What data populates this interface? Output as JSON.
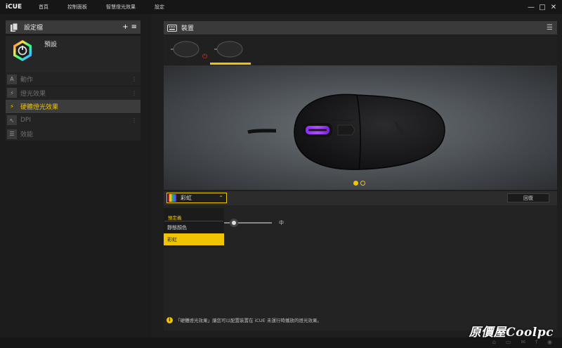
{
  "app": {
    "title": "iCUE"
  },
  "nav": [
    "首頁",
    "控制面板",
    "智慧燈光效果",
    "設定"
  ],
  "window_controls": [
    "—",
    "□",
    "✕"
  ],
  "profiles": {
    "title": "設定檔",
    "add": "+",
    "menu": "≡",
    "items": [
      {
        "name": "預設"
      }
    ]
  },
  "menu": [
    {
      "label": "動作",
      "icon": "A",
      "active": false,
      "more": "⋮"
    },
    {
      "label": "燈光效果",
      "icon": "⚡",
      "active": false,
      "more": "⋮"
    },
    {
      "label": "硬體燈光效果",
      "icon": "⚡",
      "active": true,
      "more": ""
    },
    {
      "label": "DPI",
      "icon": "↖",
      "active": false,
      "more": "⋮"
    },
    {
      "label": "效能",
      "icon": "☰",
      "active": false,
      "more": ""
    }
  ],
  "device": {
    "title": "裝置",
    "menu_icon": "☰",
    "power_icon": "⏻"
  },
  "lighting": {
    "effect": "彩虹",
    "restore": "回復",
    "dropdown_group": "預定義",
    "options": [
      {
        "label": "靜態顏色",
        "selected": false
      },
      {
        "label": "彩虹",
        "selected": true
      }
    ],
    "speed_label": "中",
    "speed": 0.2
  },
  "info_text": "「硬體燈光效果」讓您可以配置裝置在 iCUE 未運行時播放的燈光效果。",
  "footer_icons": [
    "⌂",
    "▭",
    "✉",
    "f",
    "◉"
  ],
  "watermark": "原價屋Coolpc",
  "colors": {
    "accent": "#f0c400",
    "power": "#e23b2e"
  }
}
